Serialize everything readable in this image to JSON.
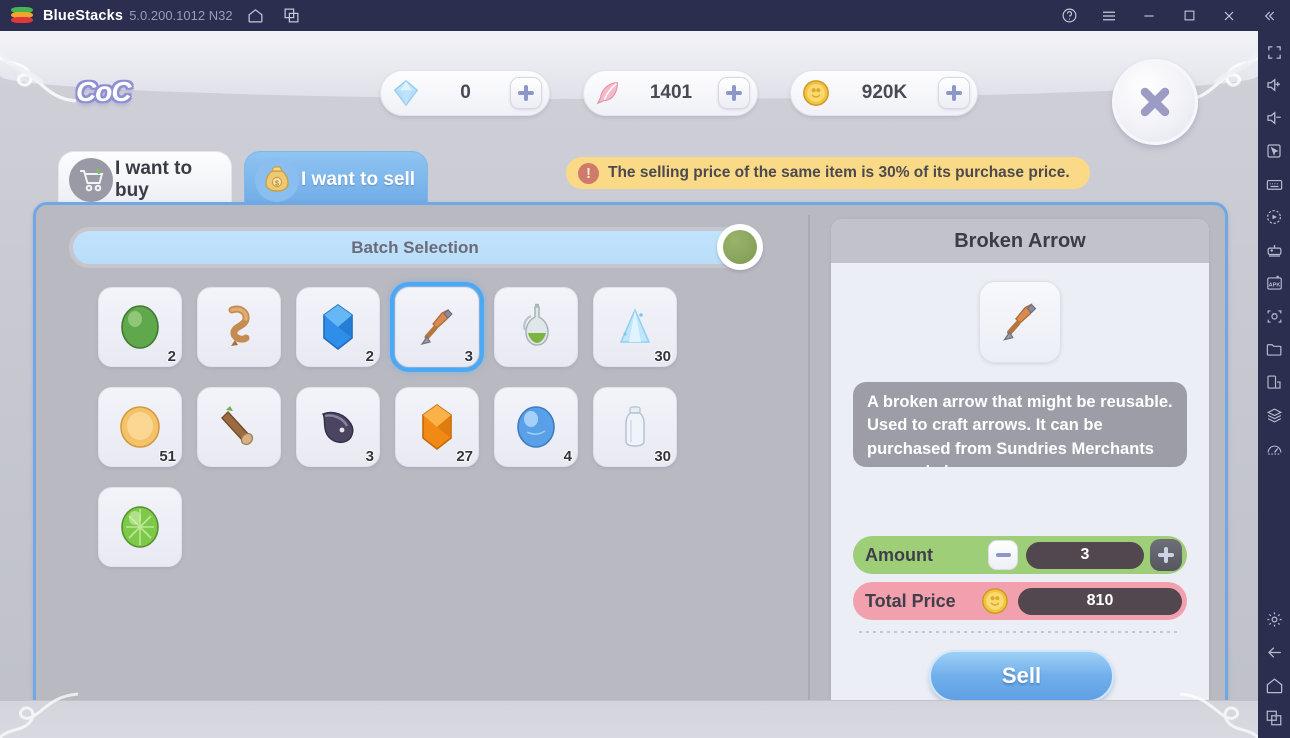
{
  "titlebar": {
    "app_name": "BlueStacks",
    "version": "5.0.200.1012 N32",
    "icons": [
      "home-icon",
      "multi-instance-icon"
    ],
    "right_icons": [
      "help-icon",
      "menu-icon",
      "minimize-icon",
      "maximize-icon",
      "close-icon",
      "collapse-icon"
    ]
  },
  "sidebar": {
    "items": [
      {
        "name": "fullscreen-icon"
      },
      {
        "name": "volume-up-icon"
      },
      {
        "name": "volume-down-icon"
      },
      {
        "name": "cursor-pointer-icon"
      },
      {
        "name": "keyboard-controls-icon"
      },
      {
        "name": "macro-recorder-icon"
      },
      {
        "name": "gamepad-icon"
      },
      {
        "name": "install-apk-icon"
      },
      {
        "name": "screenshot-icon"
      },
      {
        "name": "media-folder-icon"
      },
      {
        "name": "multi-instance-icon"
      },
      {
        "name": "eco-mode-icon"
      },
      {
        "name": "performance-meter-icon"
      }
    ],
    "bottom_items": [
      {
        "name": "settings-gear-icon"
      },
      {
        "name": "back-arrow-icon"
      },
      {
        "name": "home-icon"
      },
      {
        "name": "recent-apps-icon"
      }
    ]
  },
  "game": {
    "logo": "CoC",
    "close_button": "close-icon",
    "resources": [
      {
        "id": "gem",
        "icon": "diamond-icon",
        "value": "0",
        "add_label": "+"
      },
      {
        "id": "feather",
        "icon": "feather-icon",
        "value": "1401",
        "add_label": "+"
      },
      {
        "id": "coin",
        "icon": "gold-coin-icon",
        "value": "920K",
        "add_label": "+"
      }
    ],
    "tabs": [
      {
        "id": "buy",
        "label": "I want to buy",
        "icon": "shopping-cart-icon",
        "active": false
      },
      {
        "id": "sell",
        "label": "I want to sell",
        "icon": "money-bag-icon",
        "active": true
      }
    ],
    "notice": {
      "icon": "exclamation-icon",
      "text": "The selling price of the same item is 30% of its purchase price."
    },
    "batch": {
      "label": "Batch Selection",
      "toggle_name": "batch-selection-toggle",
      "toggle_on": false
    },
    "inventory": [
      {
        "id": "slot-1",
        "icon": "green-orb-icon",
        "count": "2",
        "selected": false
      },
      {
        "id": "slot-2",
        "icon": "worm-icon",
        "count": "",
        "selected": false
      },
      {
        "id": "slot-3",
        "icon": "blue-gem-icon",
        "count": "2",
        "selected": false
      },
      {
        "id": "slot-4",
        "icon": "broken-arrow-icon",
        "count": "3",
        "selected": true
      },
      {
        "id": "slot-5",
        "icon": "potion-flask-icon",
        "count": "",
        "selected": false
      },
      {
        "id": "slot-6",
        "icon": "ice-crystal-icon",
        "count": "30",
        "selected": false
      },
      {
        "id": "slot-7",
        "icon": "orange-egg-icon",
        "count": "51",
        "selected": false
      },
      {
        "id": "slot-8",
        "icon": "wood-log-icon",
        "count": "",
        "selected": false
      },
      {
        "id": "slot-9",
        "icon": "dark-fish-icon",
        "count": "3",
        "selected": false
      },
      {
        "id": "slot-10",
        "icon": "orange-gem-icon",
        "count": "27",
        "selected": false
      },
      {
        "id": "slot-11",
        "icon": "blue-orb-icon",
        "count": "4",
        "selected": false
      },
      {
        "id": "slot-12",
        "icon": "empty-bottle-icon",
        "count": "30",
        "selected": false
      },
      {
        "id": "slot-13",
        "icon": "lime-orb-icon",
        "count": "",
        "selected": false
      }
    ],
    "detail": {
      "title": "Broken Arrow",
      "icon": "broken-arrow-icon",
      "description": "A broken arrow that might be reusable. Used to craft arrows. It can be purchased from Sundries Merchants or wand shops.",
      "amount_label": "Amount",
      "amount_value": "3",
      "decrease_label": "-",
      "increase_label": "+",
      "price_label": "Total Price",
      "price_icon": "gold-coin-icon",
      "price_value": "810",
      "sell_label": "Sell"
    }
  },
  "colors": {
    "chrome_bg": "#2b2e4f",
    "tab_active": "#6fabe6",
    "notice_bg": "#fada87",
    "amount_row": "#9fce79",
    "price_row": "#f2a0ae",
    "panel_border": "#6ea9e6",
    "sell_button": "#72b0ec"
  }
}
